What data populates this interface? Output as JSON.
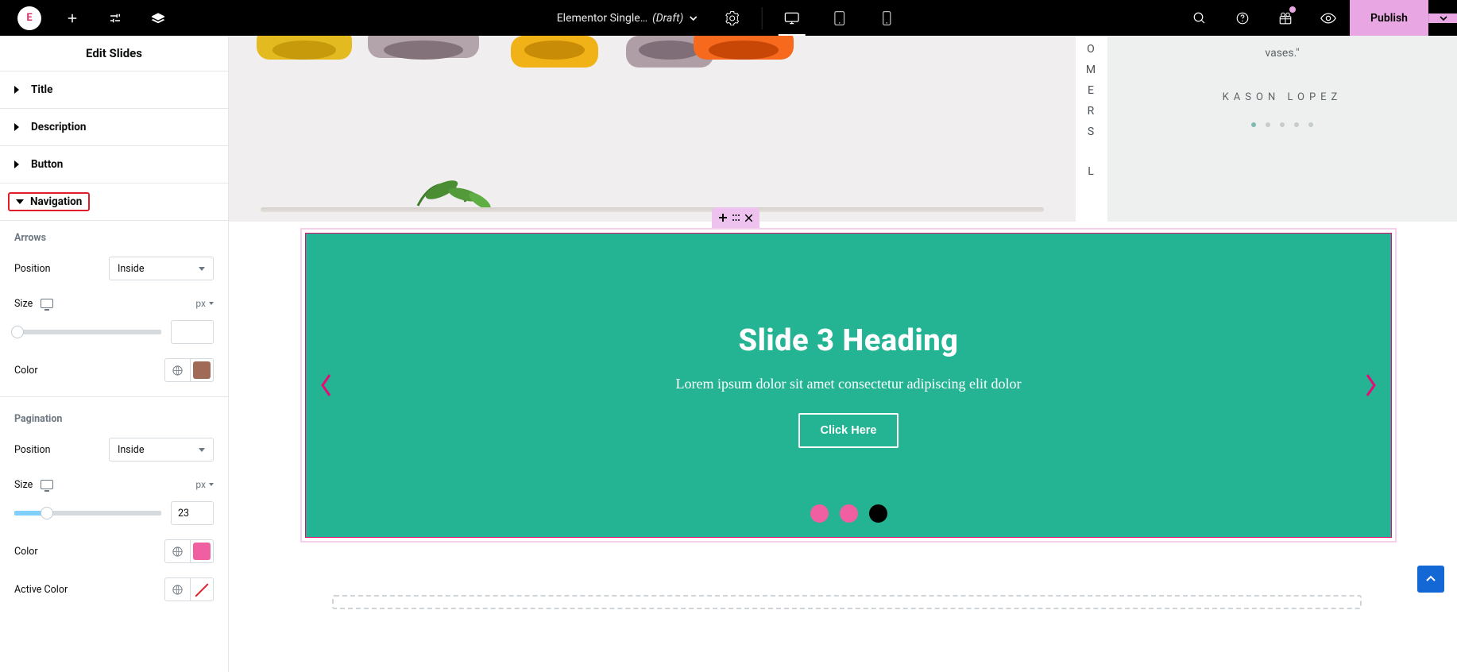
{
  "topbar": {
    "logo_letter": "E",
    "doc_name": "Elementor Single…",
    "doc_status": "(Draft)",
    "publish_label": "Publish"
  },
  "panel": {
    "header": "Edit Slides",
    "sections": {
      "title": "Title",
      "description": "Description",
      "button": "Button",
      "navigation": "Navigation"
    },
    "arrows": {
      "heading": "Arrows",
      "position_label": "Position",
      "position_value": "Inside",
      "size_label": "Size",
      "size_unit": "px",
      "size_value": "",
      "color_label": "Color",
      "color_value": "#a06a57"
    },
    "pagination": {
      "heading": "Pagination",
      "position_label": "Position",
      "position_value": "Inside",
      "size_label": "Size",
      "size_unit": "px",
      "size_value": "23",
      "size_fill_percent": 20,
      "color_label": "Color",
      "color_value": "#ef5fa1",
      "active_color_label": "Active Color"
    }
  },
  "canvas": {
    "vletters": [
      "O",
      "M",
      "E",
      "R",
      "S",
      "",
      "L"
    ],
    "testimonial": {
      "quote": "vases.\"",
      "author": "KASON LOPEZ",
      "dot_count": 5,
      "active_dot": 0
    },
    "slide": {
      "title": "Slide 3 Heading",
      "description": "Lorem ipsum dolor sit amet consectetur adipiscing elit dolor",
      "button": "Click Here"
    }
  }
}
